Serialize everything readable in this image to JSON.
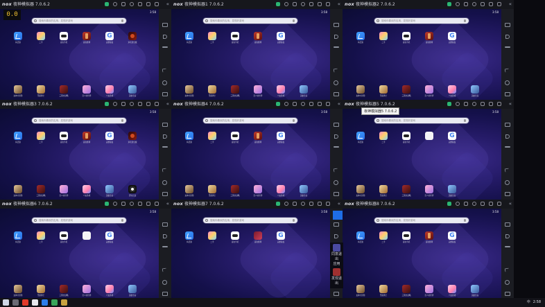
{
  "fps": "0.0",
  "tooltip": "夜神模拟器5 7.0.6.2",
  "search_placeholder": "搜索你喜欢的应用、发现好游戏",
  "status_time": "3:58",
  "windows": [
    {
      "title": "夜神模拟器 7.0.6.2",
      "top_apps": [
        [
          "folder",
          "将活源"
        ],
        [
          "erci",
          "二手"
        ],
        [
          "game",
          "喜欢手机"
        ],
        [
          "red",
          "喜欢赛场"
        ],
        [
          "google",
          "完整版权"
        ],
        [
          "devil",
          "米哈游宝藏"
        ]
      ],
      "bot_apps": [
        [
          "hero",
          "女神大冒险"
        ],
        [
          "knight",
          "圣诞勇士"
        ],
        [
          "war",
          "三国志战略"
        ],
        [
          "anime",
          "恋人的世界"
        ],
        [
          "anime2",
          "少女养成"
        ],
        [
          "castle",
          "英雄奇兵"
        ]
      ]
    },
    {
      "title": "夜神模拟器1 7.0.6.2",
      "top_apps": [
        [
          "folder",
          "将活源"
        ],
        [
          "erci",
          "二手"
        ],
        [
          "game",
          "喜欢手机"
        ],
        [
          "red",
          "喜欢赛场"
        ],
        [
          "google",
          "完整版权"
        ]
      ],
      "bot_apps": [
        [
          "hero",
          "女神大冒险"
        ],
        [
          "knight",
          "圣诞勇士"
        ],
        [
          "war",
          "三国志战略"
        ],
        [
          "anime",
          "恋人的世界"
        ],
        [
          "anime2",
          "少女养成"
        ],
        [
          "castle",
          "英雄奇兵"
        ]
      ]
    },
    {
      "title": "夜神模拟器2 7.0.6.2",
      "top_apps": [
        [
          "folder",
          "将活源"
        ],
        [
          "erci",
          "二手"
        ],
        [
          "game",
          "喜欢手机"
        ],
        [
          "red",
          "喜欢赛场"
        ],
        [
          "google",
          "完整版权"
        ]
      ],
      "bot_apps": [
        [
          "hero",
          "女神大冒险"
        ],
        [
          "knight",
          "圣诞勇士"
        ],
        [
          "war",
          "三国志战略"
        ],
        [
          "anime",
          "恋人的世界"
        ],
        [
          "anime2",
          "少女养成"
        ],
        [
          "castle",
          "英雄奇兵"
        ]
      ]
    },
    {
      "title": "夜神模拟器3 7.0.6.2",
      "top_apps": [
        [
          "folder",
          "将活源"
        ],
        [
          "erci",
          "二手"
        ],
        [
          "game",
          "喜欢手机"
        ],
        [
          "red",
          "喜欢赛场"
        ],
        [
          "google",
          "完整版权"
        ],
        [
          "devil",
          "米哈游宝藏"
        ]
      ],
      "bot_apps": [
        [
          "hero",
          "女神大冒险"
        ],
        [
          "war",
          "三国志战略"
        ],
        [
          "anime",
          "恋人的世界"
        ],
        [
          "anime2",
          "少女养成"
        ],
        [
          "castle",
          "英雄奇兵"
        ],
        [
          "soccer",
          "足球之夜"
        ]
      ]
    },
    {
      "title": "夜神模拟器4 7.0.6.2",
      "top_apps": [
        [
          "folder",
          "将活源"
        ],
        [
          "erci",
          "二手"
        ],
        [
          "game",
          "喜欢手机"
        ],
        [
          "red",
          "喜欢赛场"
        ],
        [
          "google",
          "完整版权"
        ]
      ],
      "bot_apps": [
        [
          "hero",
          "女神大冒险"
        ],
        [
          "knight",
          "圣诞勇士"
        ],
        [
          "war",
          "三国志战略"
        ],
        [
          "anime",
          "恋人的世界"
        ],
        [
          "anime2",
          "少女养成"
        ],
        [
          "castle",
          "英雄奇兵"
        ]
      ]
    },
    {
      "title": "夜神模拟器5 7.0.6.2",
      "top_apps": [
        [
          "folder",
          "将活源"
        ],
        [
          "erci",
          "二手"
        ],
        [
          "game",
          "喜欢手机"
        ],
        [
          "blank",
          ""
        ],
        [
          "google",
          "完整版权"
        ]
      ],
      "bot_apps": [
        [
          "hero",
          "女神大冒险"
        ],
        [
          "knight",
          "圣诞勇士"
        ],
        [
          "war",
          "三国志战略"
        ],
        [
          "anime",
          "恋人的世界"
        ],
        [
          "castle",
          "英雄奇兵"
        ]
      ]
    },
    {
      "title": "夜神模拟器6 7.0.6.2",
      "top_apps": [
        [
          "folder",
          "将活源"
        ],
        [
          "erci",
          "二手"
        ],
        [
          "game",
          "喜欢手机"
        ],
        [
          "blank",
          ""
        ],
        [
          "google",
          "完整版权"
        ]
      ],
      "bot_apps": [
        [
          "hero",
          "女神大冒险"
        ],
        [
          "knight",
          "圣诞勇士"
        ],
        [
          "war",
          "三国志战略"
        ],
        [
          "anime",
          "恋人的世界"
        ],
        [
          "anime2",
          "少女养成"
        ],
        [
          "castle",
          "英雄奇兵"
        ]
      ]
    },
    {
      "title": "夜神模拟器7 7.0.6.2",
      "top_apps": [
        [
          "folder",
          "将活源"
        ],
        [
          "erci",
          "二手"
        ],
        [
          "game",
          "喜欢手机"
        ],
        [
          "redbig",
          "喜欢赛场"
        ],
        [
          "google",
          "完整版权"
        ]
      ],
      "bot_apps": []
    },
    {
      "title": "夜神模拟器8 7.0.6.2",
      "top_apps": [
        [
          "folder",
          "将活源"
        ],
        [
          "erci",
          "二手"
        ],
        [
          "game",
          "喜欢手机"
        ],
        [
          "red",
          "喜欢赛场"
        ],
        [
          "google",
          "完整版权"
        ]
      ],
      "bot_apps": [
        [
          "hero",
          "女神大冒险"
        ],
        [
          "knight",
          "圣诞勇士"
        ],
        [
          "war",
          "三国志战略"
        ],
        [
          "anime",
          "恋人的世界"
        ],
        [
          "anime2",
          "少女养成"
        ],
        [
          "castle",
          "英雄奇兵"
        ]
      ]
    }
  ],
  "overlay_labels": [
    "同意退出",
    "应用",
    "发现退出"
  ],
  "taskbar": {
    "time": "2:58",
    "tray_lang": "中"
  }
}
